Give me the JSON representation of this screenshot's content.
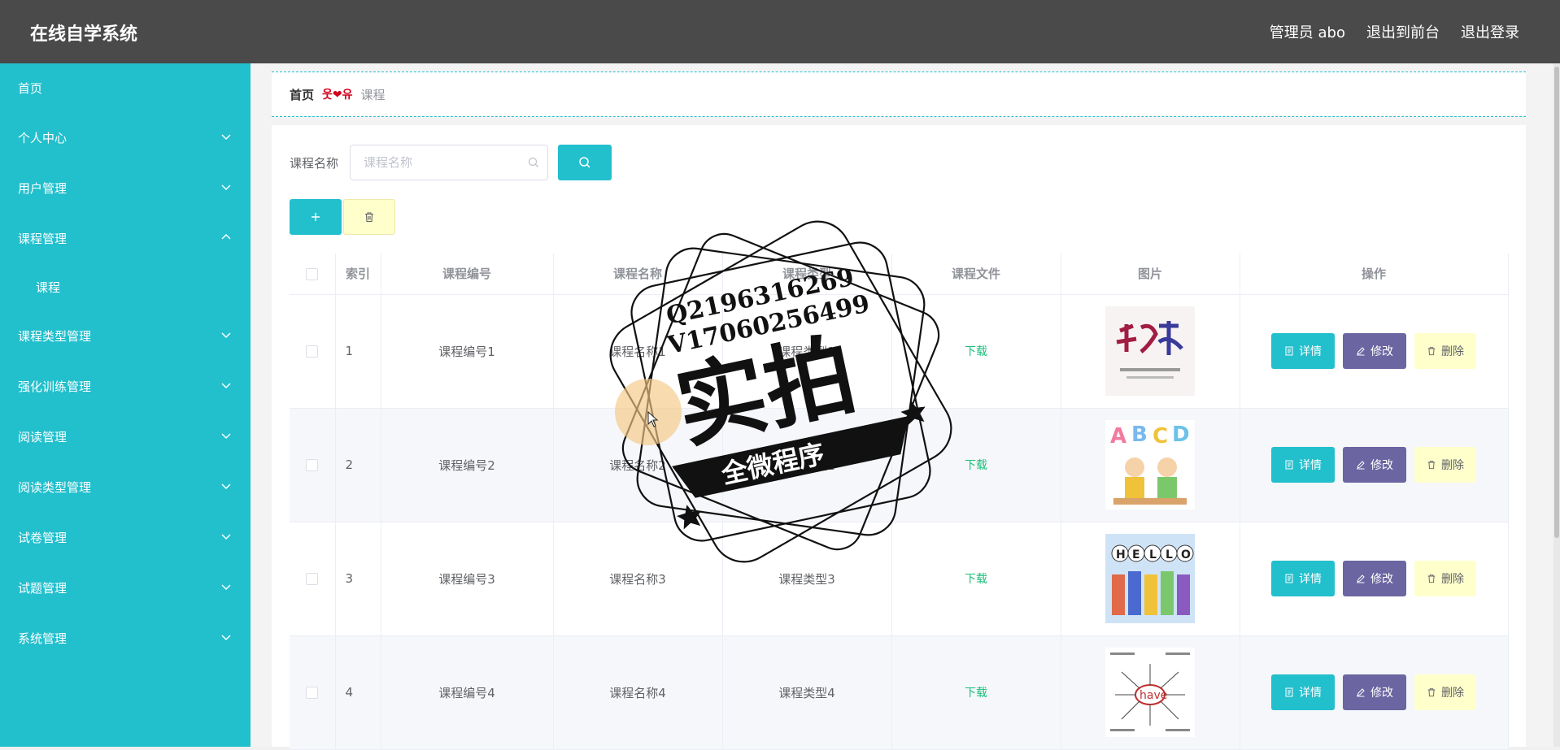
{
  "header": {
    "title": "在线自学系统",
    "user_label": "管理员 abo",
    "to_front_label": "退出到前台",
    "logout_label": "退出登录"
  },
  "sidebar": {
    "items": [
      {
        "label": "首页",
        "expandable": false
      },
      {
        "label": "个人中心",
        "expandable": true
      },
      {
        "label": "用户管理",
        "expandable": true
      },
      {
        "label": "课程管理",
        "expandable": true,
        "expanded": true,
        "children": [
          "课程"
        ]
      },
      {
        "label": "课程类型管理",
        "expandable": true
      },
      {
        "label": "强化训练管理",
        "expandable": true
      },
      {
        "label": "阅读管理",
        "expandable": true
      },
      {
        "label": "阅读类型管理",
        "expandable": true
      },
      {
        "label": "试卷管理",
        "expandable": true
      },
      {
        "label": "试题管理",
        "expandable": true
      },
      {
        "label": "系统管理",
        "expandable": true
      }
    ]
  },
  "breadcrumb": {
    "home": "首页",
    "separator": "웃❤유",
    "current": "课程"
  },
  "search": {
    "label": "课程名称",
    "placeholder": "课程名称"
  },
  "table": {
    "columns": [
      "索引",
      "课程编号",
      "课程名称",
      "课程类型",
      "课程文件",
      "图片",
      "操作"
    ],
    "rows": [
      {
        "index": "1",
        "code": "课程编号1",
        "name": "课程名称1",
        "type": "课程类型1",
        "file": "下载",
        "image": "jianshen-thumbnail"
      },
      {
        "index": "2",
        "code": "课程编号2",
        "name": "课程名称2",
        "type": "课程类型2",
        "file": "下载",
        "image": "abcd-thumbnail"
      },
      {
        "index": "3",
        "code": "课程编号3",
        "name": "课程名称3",
        "type": "课程类型3",
        "file": "下载",
        "image": "hello-thumbnail"
      },
      {
        "index": "4",
        "code": "课程编号4",
        "name": "课程名称4",
        "type": "课程类型4",
        "file": "下载",
        "image": "have-thumbnail"
      }
    ],
    "actions": {
      "detail": "详情",
      "edit": "修改",
      "delete": "删除"
    }
  },
  "watermark": {
    "line1": "Q2196316269",
    "line2": "V17060256499",
    "main": "实拍",
    "banner": "全微程序"
  },
  "colors": {
    "header_bg": "#4a4a4a",
    "sidebar_bg": "#22bfcc",
    "primary": "#22bfcc",
    "edit": "#6b65a1",
    "delete_bg": "#ffffcc",
    "download": "#1bbf7a"
  }
}
